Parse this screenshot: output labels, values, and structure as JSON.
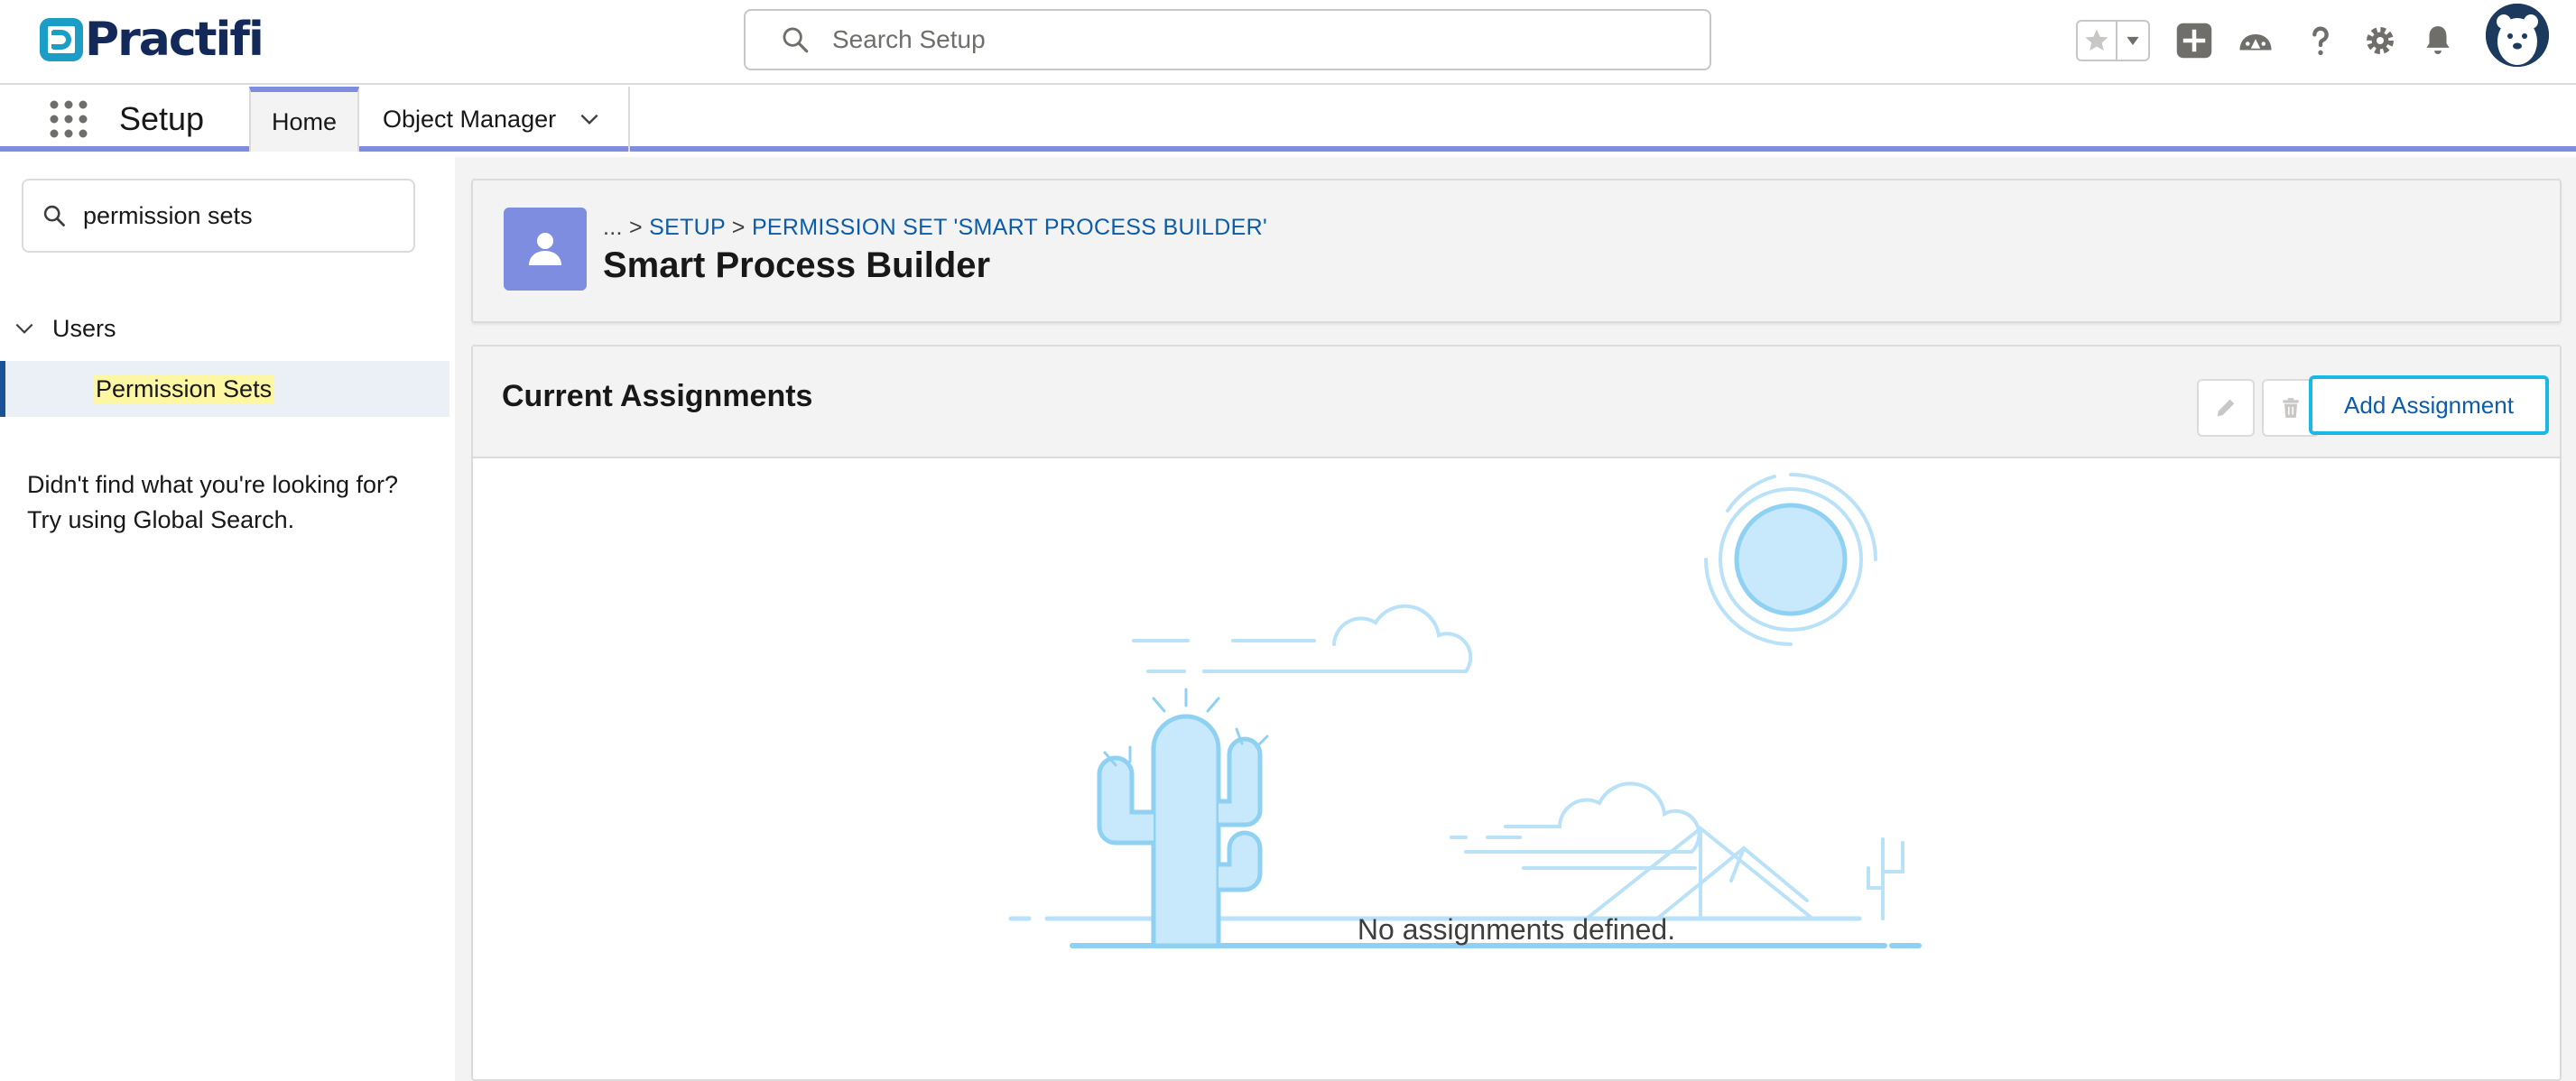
{
  "header": {
    "logo_text": "Practifi",
    "search_placeholder": "Search Setup",
    "icons": [
      "star-icon",
      "chevron-down-icon",
      "add-icon",
      "trailhead-icon",
      "help-icon",
      "gear-icon",
      "bell-icon",
      "avatar"
    ]
  },
  "context_bar": {
    "app_name": "Setup",
    "tabs": [
      {
        "label": "Home",
        "active": true
      },
      {
        "label": "Object Manager",
        "active": false
      }
    ]
  },
  "sidebar": {
    "quick_find_value": "permission sets",
    "tree": {
      "group_label": "Users",
      "item_label": "Permission Sets"
    },
    "help_line1": "Didn't find what you're looking for?",
    "help_line2": "Try using Global Search."
  },
  "page_header": {
    "breadcrumb_ellipsis": "... >",
    "breadcrumb_setup": "SETUP",
    "breadcrumb_sep": ">",
    "breadcrumb_current": "PERMISSION SET 'SMART PROCESS BUILDER'",
    "title": "Smart Process Builder"
  },
  "assignments": {
    "title": "Current Assignments",
    "add_button": "Add Assignment",
    "empty_message": "No assignments defined."
  },
  "colors": {
    "brand_navy": "#13295a",
    "brand_teal": "#1b9dc6",
    "accent": "#7f8de1",
    "link": "#0b5cab",
    "illustration": "#8fd1f2"
  }
}
